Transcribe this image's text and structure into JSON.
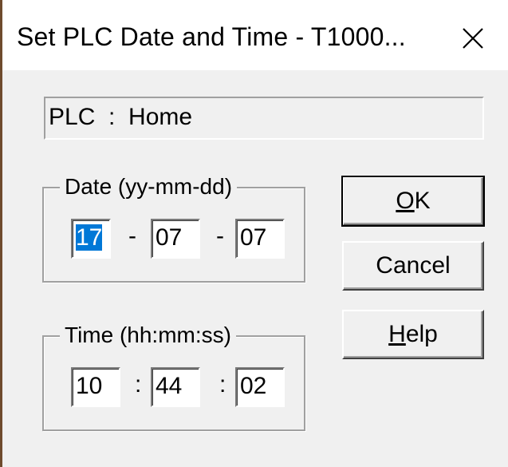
{
  "window": {
    "title": "Set PLC Date and Time - T1000...",
    "close_icon": "close-icon"
  },
  "plc": {
    "label": "PLC  :  Home"
  },
  "date_group": {
    "legend": "Date (yy-mm-dd)",
    "yy": "17",
    "mm": "07",
    "dd": "07",
    "separator": "-"
  },
  "time_group": {
    "legend": "Time (hh:mm:ss)",
    "hh": "10",
    "mm": "44",
    "ss": "02",
    "separator": ":"
  },
  "buttons": {
    "ok": {
      "mnemonic": "O",
      "rest": "K"
    },
    "cancel": "Cancel",
    "help": {
      "mnemonic": "H",
      "rest": "elp"
    }
  },
  "colors": {
    "selection": "#0078d7",
    "window_border": "#6e4b2d",
    "dialog_bg": "#f0f0f0"
  }
}
